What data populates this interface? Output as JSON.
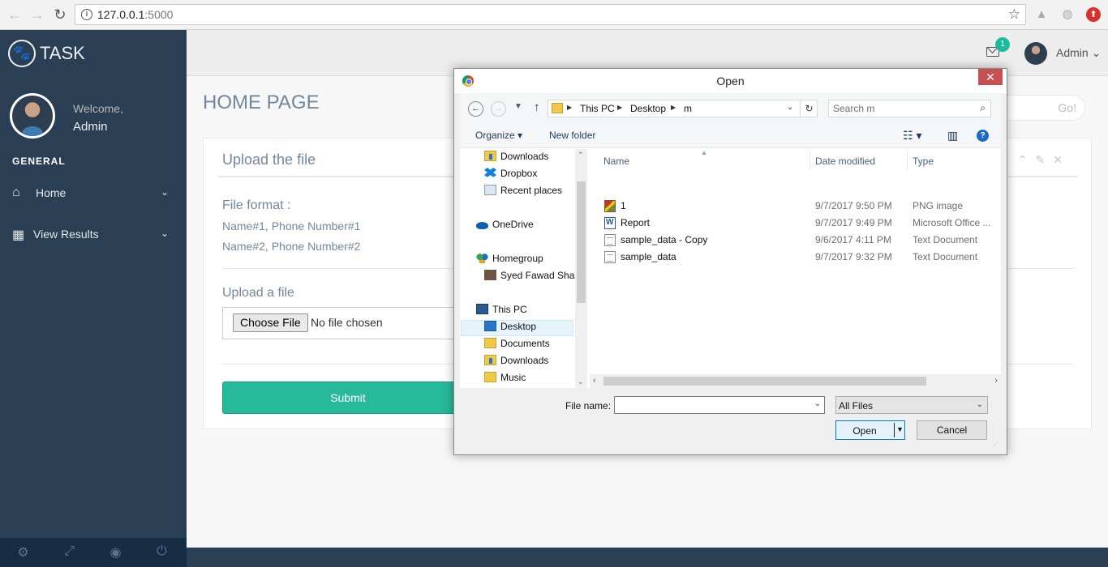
{
  "browser": {
    "url_host": "127.0.0.1",
    "url_port": ":5000"
  },
  "app": {
    "brand": "TASK",
    "welcome": "Welcome,",
    "user": "Admin",
    "section": "GENERAL",
    "menu": [
      {
        "label": "Home",
        "icon": "home-icon"
      },
      {
        "label": "View Results",
        "icon": "table-icon"
      }
    ],
    "footer_icons": [
      "gear-icon",
      "fullscreen-icon",
      "eye-slash-icon",
      "power-icon"
    ]
  },
  "topnav": {
    "mail_count": "1",
    "user": "Admin"
  },
  "page": {
    "title": "HOME PAGE",
    "search_go": "Go!",
    "panel_title": "Upload the file",
    "file_format_label": "File format :",
    "format_lines": [
      "Name#1, Phone Number#1",
      "Name#2, Phone Number#2"
    ],
    "upload_label": "Upload a file",
    "choose_file": "Choose File",
    "no_file": "No file chosen",
    "submit": "Submit"
  },
  "dialog": {
    "title": "Open",
    "close": "✕",
    "breadcrumb": [
      "This PC",
      "Desktop",
      "m"
    ],
    "search_placeholder": "Search m",
    "organize": "Organize ▾",
    "new_folder": "New folder",
    "tree": [
      {
        "label": "Downloads",
        "icon": "downloads-folder-icon"
      },
      {
        "label": "Dropbox",
        "icon": "dropbox-icon"
      },
      {
        "label": "Recent places",
        "icon": "recent-places-icon"
      },
      {
        "label": "OneDrive",
        "icon": "onedrive-icon"
      },
      {
        "label": "Homegroup",
        "icon": "homegroup-icon"
      },
      {
        "label": "Syed Fawad Shah",
        "icon": "user-icon"
      },
      {
        "label": "This PC",
        "icon": "this-pc-icon"
      },
      {
        "label": "Desktop",
        "icon": "desktop-folder-icon",
        "selected": true
      },
      {
        "label": "Documents",
        "icon": "documents-folder-icon"
      },
      {
        "label": "Downloads",
        "icon": "downloads-folder-icon"
      },
      {
        "label": "Music",
        "icon": "music-folder-icon"
      }
    ],
    "columns": [
      "Name",
      "Date modified",
      "Type"
    ],
    "files": [
      {
        "name": "1",
        "date": "9/7/2017 9:50 PM",
        "type": "PNG image",
        "icon": "png-image-icon"
      },
      {
        "name": "Report",
        "date": "9/7/2017 9:49 PM",
        "type": "Microsoft Office ...",
        "icon": "word-document-icon"
      },
      {
        "name": "sample_data - Copy",
        "date": "9/6/2017 4:11 PM",
        "type": "Text Document",
        "icon": "text-document-icon"
      },
      {
        "name": "sample_data",
        "date": "9/7/2017 9:32 PM",
        "type": "Text Document",
        "icon": "text-document-icon"
      }
    ],
    "file_name_label": "File name:",
    "file_name_value": "",
    "file_type": "All Files",
    "open": "Open",
    "cancel": "Cancel"
  },
  "colors": {
    "sidebar": "#2a3f54",
    "accent": "#26b99a",
    "badge": "#1abb9c",
    "dialog_close": "#c75050"
  }
}
